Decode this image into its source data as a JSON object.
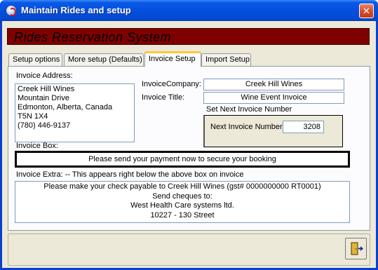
{
  "window": {
    "title": "Maintain Rides and setup"
  },
  "banner": {
    "title": "Rides Reservation  System"
  },
  "tabs": [
    {
      "label": "Setup options"
    },
    {
      "label": "More setup (Defaults)"
    },
    {
      "label": "Invoice Setup"
    },
    {
      "label": "Import Setup"
    }
  ],
  "invoice": {
    "address_label": "Invoice Address:",
    "address_lines": [
      "Creek Hill Wines",
      "Mountain Drive",
      "Edmonton, Alberta, Canada",
      "T5N 1X4",
      "(780) 446-9137"
    ],
    "company_label": "InvoiceCompany:",
    "company_value": "Creek Hill Wines",
    "title_label": "Invoice Title:",
    "title_value": "Wine Event Invoice",
    "next_group_label": "Set Next Invoice Number",
    "next_label": "Next Invoice Number",
    "next_value": "3208",
    "box_label": "Invoice Box:",
    "box_value": "Please send your payment now to secure your booking",
    "extra_label": "Invoice Extra: -- This appears right below the above box on invoice",
    "extra_lines": [
      "Please make your check payable to Creek Hill Wines  (gst# 0000000000 RT0001)",
      "Send cheques to:",
      "West Health Care systems ltd.",
      "10227 - 130 Street"
    ]
  },
  "icons": {
    "app": "app-icon",
    "close": "close-icon",
    "exit": "exit-door-icon"
  },
  "colors": {
    "banner_bg": "#7f0000",
    "active_tab_accent": "#ffc83c",
    "titlebar": "#0350dd"
  }
}
